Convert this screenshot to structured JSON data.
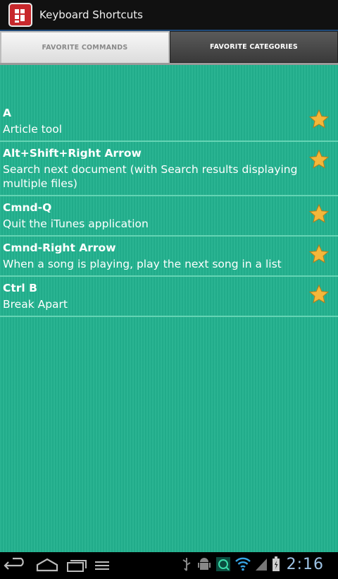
{
  "app": {
    "title": "Keyboard Shortcuts"
  },
  "tabs": [
    {
      "label": "FAVORITE COMMANDS",
      "active": true
    },
    {
      "label": "FAVORITE CATEGORIES",
      "active": false
    }
  ],
  "favorites": [
    {
      "key": "A",
      "description": "Article tool"
    },
    {
      "key": "Alt+Shift+Right Arrow",
      "description": "Search next document (with Search results displaying multiple files)"
    },
    {
      "key": "Cmnd-Q",
      "description": "Quit the iTunes application"
    },
    {
      "key": "Cmnd-Right Arrow",
      "description": "When a song is playing, play the next song in a list"
    },
    {
      "key": "Ctrl B",
      "description": "Break Apart"
    }
  ],
  "status": {
    "time": "2:16"
  },
  "colors": {
    "content_bg": "#22b18e",
    "star": "#f4b73a",
    "clock": "#9ec3e6"
  },
  "icons": [
    "back-icon",
    "home-icon",
    "recent-apps-icon",
    "menu-icon",
    "usb-icon",
    "android-debug-icon",
    "sync-icon",
    "wifi-icon",
    "signal-icon",
    "battery-icon",
    "star-icon"
  ]
}
